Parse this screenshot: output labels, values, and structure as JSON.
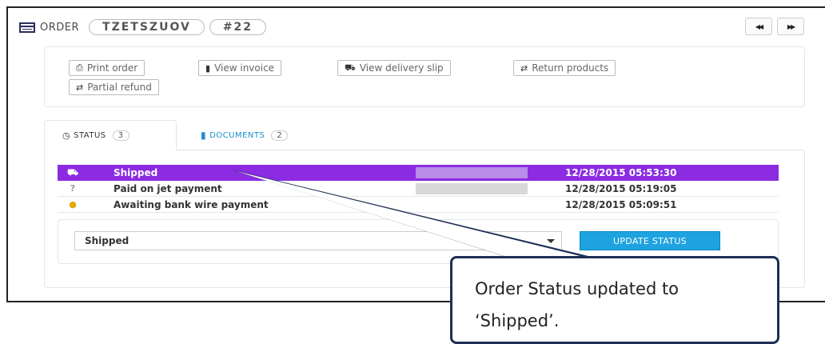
{
  "header": {
    "label": "ORDER",
    "reference": "TZETSZUOV",
    "number": "#22",
    "nav_prev_icon": "◀◀",
    "nav_next_icon": "▶▶"
  },
  "actions": [
    {
      "label": "Print order",
      "icon": "print-icon"
    },
    {
      "label": "View invoice",
      "icon": "file-icon"
    },
    {
      "label": "View delivery slip",
      "icon": "truck-icon"
    },
    {
      "label": "Return products",
      "icon": "exchange-icon"
    },
    {
      "label": "Partial refund",
      "icon": "exchange-icon"
    }
  ],
  "tabs": {
    "status": {
      "label": "STATUS",
      "count": "3"
    },
    "documents": {
      "label": "DOCUMENTS",
      "count": "2"
    }
  },
  "history": [
    {
      "status": "Shipped",
      "date": "12/28/2015 05:53:30",
      "selected": true,
      "icon": "truck-icon"
    },
    {
      "status": "Paid on jet payment",
      "date": "12/28/2015 05:19:05",
      "selected": false,
      "icon": "question-icon"
    },
    {
      "status": "Awaiting bank wire payment",
      "date": "12/28/2015 05:09:51",
      "selected": false,
      "icon": "coins-icon"
    }
  ],
  "status_form": {
    "selected": "Shipped",
    "button": "UPDATE STATUS"
  },
  "callout": {
    "line1": "Order Status updated to",
    "line2": "‘Shipped’."
  },
  "colors": {
    "selected_row": "#8b2be2",
    "accent": "#1ea3e0",
    "callout_border": "#1f2f55"
  }
}
